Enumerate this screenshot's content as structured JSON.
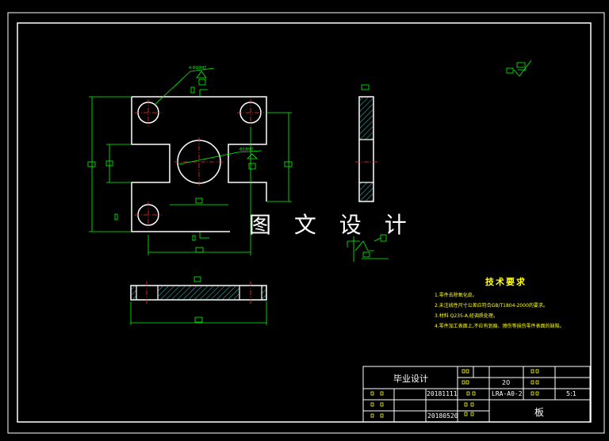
{
  "watermark": "图 文 设 计",
  "tech_requirements": {
    "title": "技术要求",
    "notes": [
      "1.零件去除氧化皮。",
      "2.未注线性尺寸公差应符合GB/T1804-2000的要求。",
      "3.材料 Q235-A,经调质处理。",
      "4.零件加工表面上,不应有划痕、擦伤等损伤零件表面的缺陷。"
    ]
  },
  "title_block": {
    "project_title": "毕业设计",
    "date_1": "20181111",
    "date_2": "20180520",
    "quantity": "20",
    "drawing_number": "LRA-A0-2",
    "scale": "5:1",
    "part_name": "板"
  },
  "colors": {
    "outline": "#ffffff",
    "dimension": "#00ff00",
    "centerline": "#ff3030",
    "hatch": "#33cccc",
    "notes": "#ffff22"
  }
}
